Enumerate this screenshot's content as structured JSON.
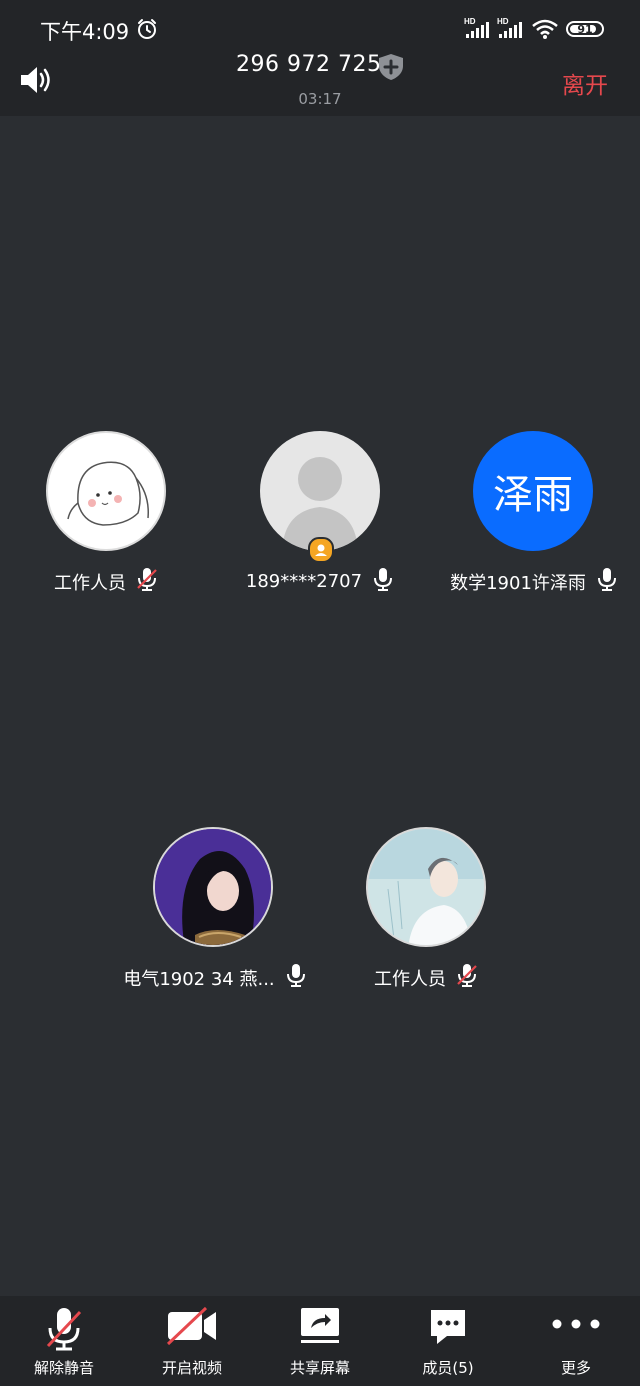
{
  "status_bar": {
    "time": "下午4:09",
    "battery": "91"
  },
  "meeting": {
    "id": "296 972 725",
    "duration": "03:17",
    "leave_label": "离开"
  },
  "participants": [
    {
      "name": "工作人员",
      "mic": "muted"
    },
    {
      "name": "189****2707",
      "mic": "on"
    },
    {
      "name": "数学1901许泽雨",
      "mic": "on",
      "avatar_text": "泽雨"
    },
    {
      "name": "电气1902 34 燕...",
      "mic": "on"
    },
    {
      "name": "工作人员",
      "mic": "muted"
    }
  ],
  "toolbar": {
    "unmute": "解除静音",
    "start_video": "开启视频",
    "share_screen": "共享屏幕",
    "members": "成员(5)",
    "more": "更多"
  },
  "colors": {
    "accent_blue": "#0a6cff",
    "leave_red": "#e5484d",
    "background": "#2b2e32"
  }
}
